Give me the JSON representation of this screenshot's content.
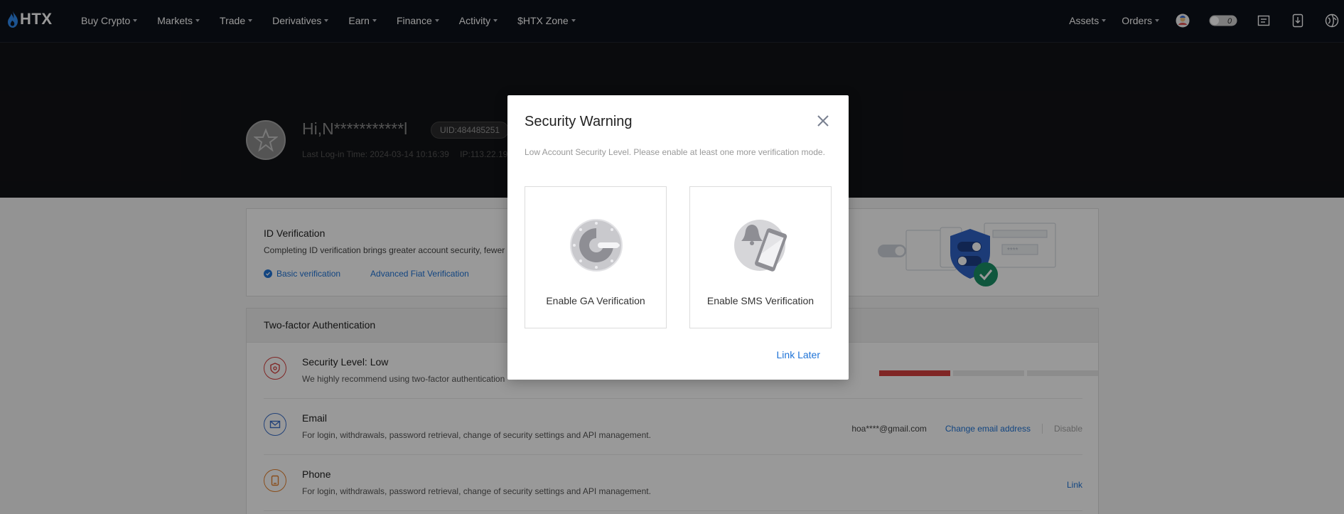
{
  "nav": {
    "logo_text": "HTX",
    "left_items": [
      {
        "label": "Buy Crypto"
      },
      {
        "label": "Markets"
      },
      {
        "label": "Trade"
      },
      {
        "label": "Derivatives"
      },
      {
        "label": "Earn"
      },
      {
        "label": "Finance"
      },
      {
        "label": "Activity"
      },
      {
        "label": "$HTX Zone"
      }
    ],
    "right_items": [
      {
        "label": "Assets"
      },
      {
        "label": "Orders"
      }
    ],
    "icons": [
      "avatar-icon",
      "toggle-icon",
      "notes-icon",
      "download-icon",
      "language-icon"
    ],
    "toggle_value": "0"
  },
  "profile": {
    "greeting": "Hi,N***********l",
    "uid": "UID:484485251",
    "last_login": "Last Log-in Time: 2024-03-14 10:16:39",
    "ip": "IP:113.22.19"
  },
  "id_verification": {
    "title": "ID Verification",
    "desc": "Completing ID verification brings greater account security, fewer",
    "basic": "Basic verification",
    "advanced": "Advanced Fiat Verification"
  },
  "two_factor": {
    "title": "Two-factor Authentication",
    "rows": [
      {
        "title": "Security Level: Low",
        "desc": "We highly recommend using two-factor authentication",
        "level": 1,
        "level_of": 3
      },
      {
        "title": "Email",
        "desc": "For login, withdrawals, password retrieval, change of security settings and API management.",
        "value": "hoa****@gmail.com",
        "action": "Change email address",
        "disable": "Disable"
      },
      {
        "title": "Phone",
        "desc": "For login, withdrawals, password retrieval, change of security settings and API management.",
        "action": "Link"
      }
    ]
  },
  "modal": {
    "title": "Security Warning",
    "desc": "Low Account Security Level. Please enable at least one more verification mode.",
    "options": [
      {
        "label": "Enable GA Verification",
        "icon": "google-authenticator-icon"
      },
      {
        "label": "Enable SMS Verification",
        "icon": "sms-phone-icon"
      }
    ],
    "link_later": "Link Later"
  },
  "colors": {
    "nav_bg": "#0d111a",
    "accent_blue": "#1e73d7",
    "danger_red": "#d6403e",
    "email_icon": "#3b6fc9",
    "phone_icon": "#e5812d"
  }
}
